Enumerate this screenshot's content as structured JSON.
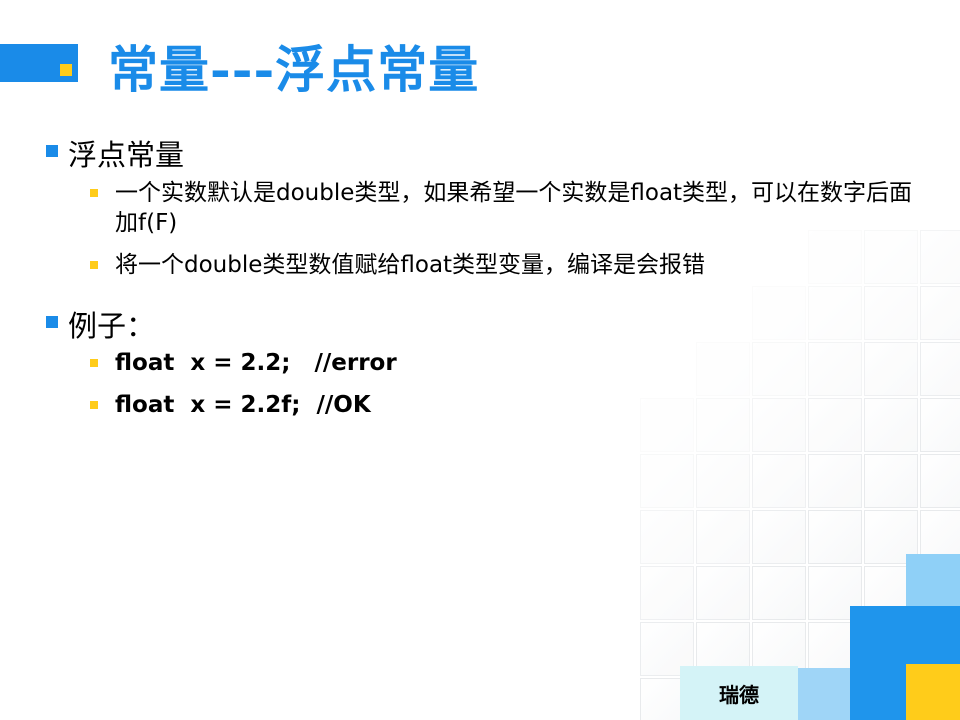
{
  "slide": {
    "title": "常量---浮点常量",
    "sections": [
      {
        "heading": "浮点常量",
        "items": [
          "一个实数默认是double类型，如果希望一个实数是float类型，可以在数字后面加f(F)",
          "将一个double类型数值赋给float类型变量，编译是会报错"
        ]
      },
      {
        "heading": "例子：",
        "items": [
          "float  x = 2.2;   //error",
          "float  x = 2.2f;  //OK"
        ]
      }
    ],
    "footer": "瑞德"
  },
  "colors": {
    "accent_blue": "#1a8be8",
    "accent_yellow": "#ffcc1a",
    "light_blue": "#8fd0f7",
    "pale_cyan": "#d4f3f7"
  }
}
